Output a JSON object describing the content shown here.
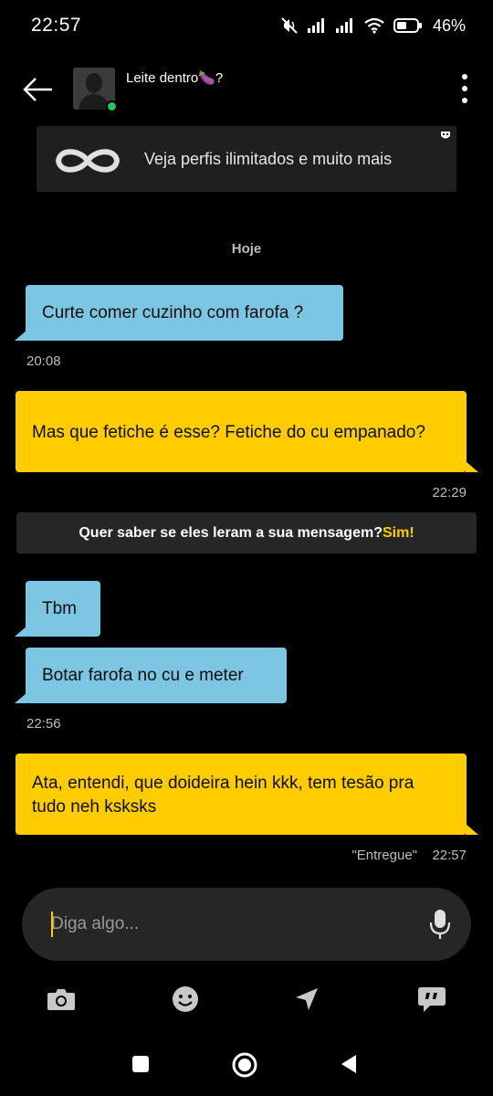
{
  "status": {
    "time": "22:57",
    "battery": "46%"
  },
  "header": {
    "contact_name": "Leite dentro🍆?"
  },
  "promo": {
    "text": "Veja perfis ilimitados e muito mais"
  },
  "day_separator": "Hoje",
  "messages": [
    {
      "dir": "in",
      "text": "Curte comer cuzinho com farofa ?",
      "time": "20:08"
    },
    {
      "dir": "out",
      "text": "Mas que fetiche é esse? Fetiche do cu empanado?",
      "time": "22:29"
    },
    {
      "dir": "in",
      "text": "Tbm"
    },
    {
      "dir": "in",
      "text": "Botar farofa no cu e meter",
      "time": "22:56"
    },
    {
      "dir": "out",
      "text": "Ata, entendi, que doideira hein kkk, tem tesão pra tudo neh ksksks",
      "status": "\"Entregue\"",
      "time": "22:57"
    }
  ],
  "read_receipt_banner": {
    "question": "Quer saber se eles leram a sua mensagem?",
    "cta": "Sim!"
  },
  "composer": {
    "placeholder": "Diga algo..."
  },
  "toolbar": [
    "camera-icon",
    "emoji-icon",
    "location-icon",
    "quick-reply-icon"
  ],
  "colors": {
    "incoming": "#7cc6e4",
    "outgoing": "#ffcc00",
    "accent": "#ffcc00",
    "online": "#22c55e"
  }
}
